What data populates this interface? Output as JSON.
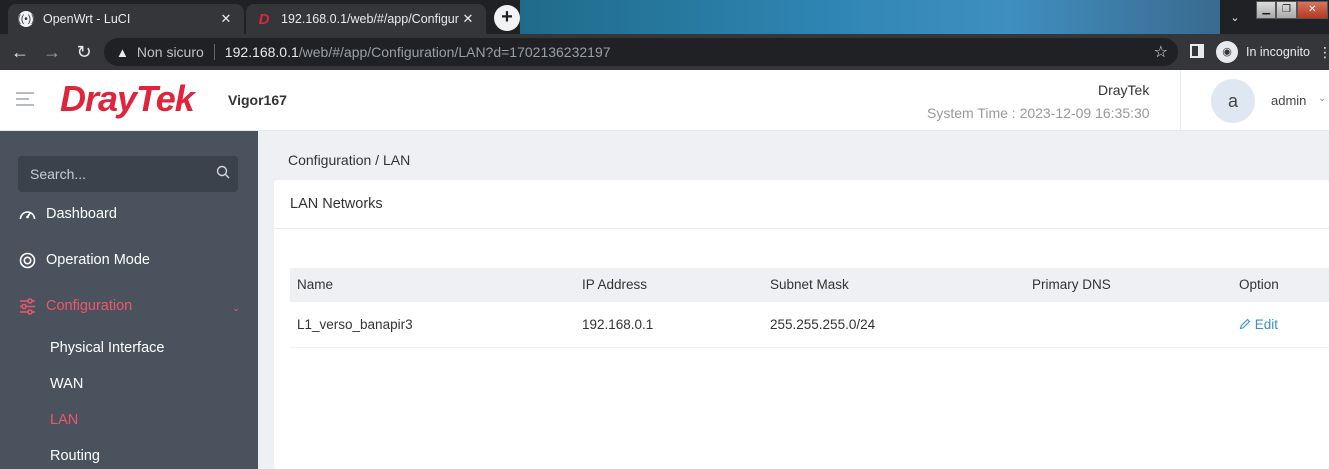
{
  "browser": {
    "tabs": [
      {
        "title": "OpenWrt - LuCI",
        "close": "✕"
      },
      {
        "title": "192.168.0.1/web/#/app/Configur",
        "close": "✕"
      }
    ],
    "new_tab": "+",
    "address": {
      "security_label": "Non sicuro",
      "host": "192.168.0.1",
      "path": "/web/#/app/Configuration/LAN?d=1702136232197"
    },
    "incognito_label": "In incognito"
  },
  "header": {
    "logo": "DrayTek",
    "model": "Vigor167",
    "brand": "DrayTek",
    "system_time": "System Time : 2023-12-09 16:35:30",
    "avatar_letter": "a",
    "username": "admin"
  },
  "sidebar": {
    "search_placeholder": "Search...",
    "items": [
      {
        "label": "Dashboard",
        "icon": "gauge-icon"
      },
      {
        "label": "Operation Mode",
        "icon": "cycle-icon"
      },
      {
        "label": "Configuration",
        "icon": "sliders-icon",
        "active": true
      }
    ],
    "subitems": [
      {
        "label": "Physical Interface"
      },
      {
        "label": "WAN"
      },
      {
        "label": "LAN",
        "active": true
      },
      {
        "label": "Routing"
      }
    ]
  },
  "content": {
    "breadcrumb": "Configuration / LAN",
    "card_title": "LAN Networks",
    "table": {
      "headers": [
        "Name",
        "IP Address",
        "Subnet Mask",
        "Primary DNS",
        "Option"
      ],
      "rows": [
        {
          "name": "L1_verso_banapir3",
          "ip": "192.168.0.1",
          "mask": "255.255.255.0/24",
          "dns": "",
          "option": "Edit"
        }
      ]
    }
  },
  "colors": {
    "brand_red": "#e0243b",
    "sidebar_bg": "#4a525e",
    "active_nav": "#f0566a",
    "link_blue": "#3a8fd0"
  }
}
